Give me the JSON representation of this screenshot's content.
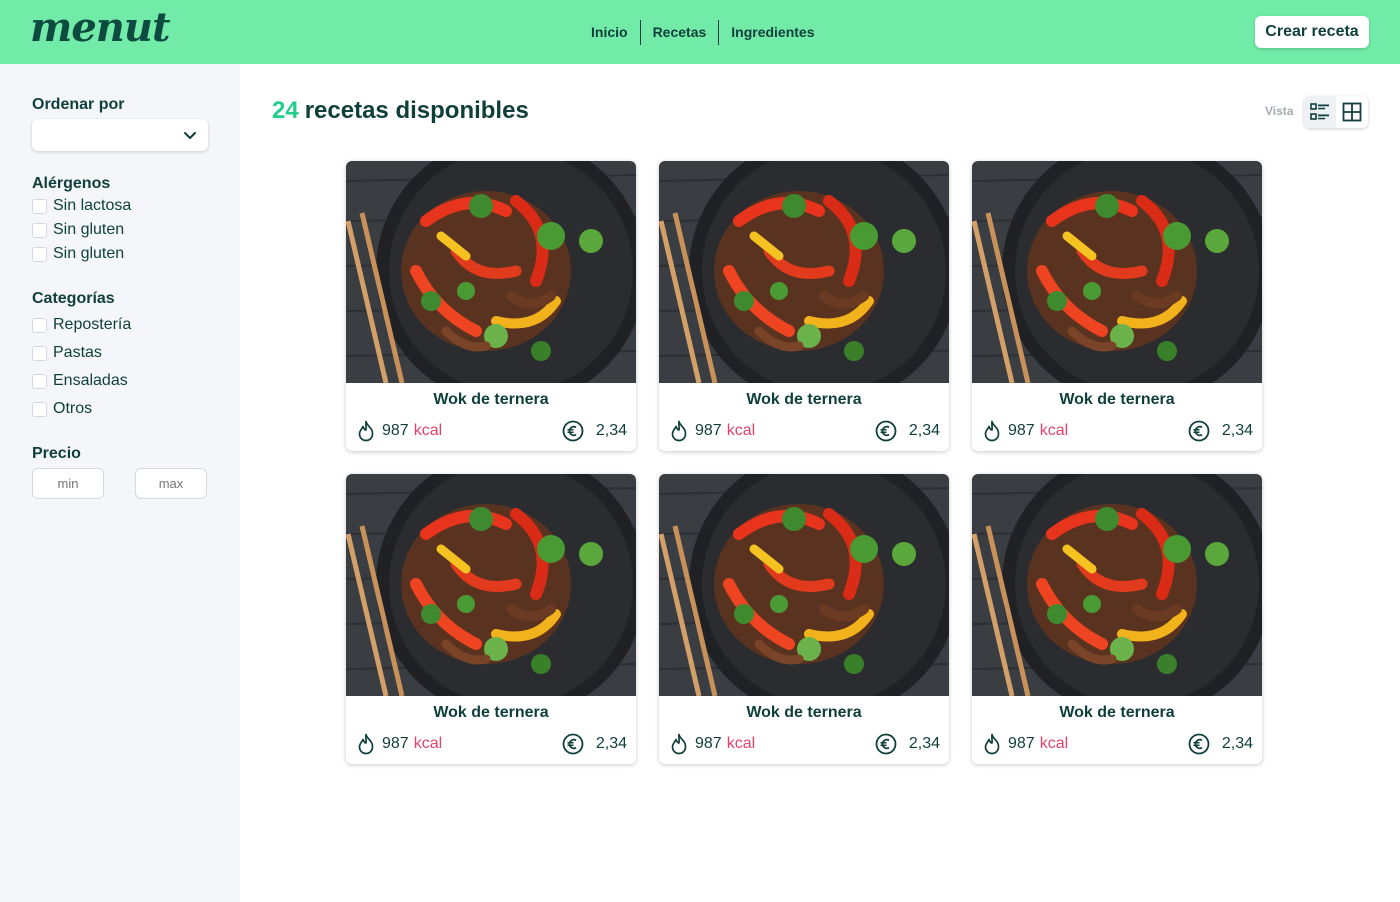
{
  "header": {
    "logo": "menut",
    "nav": [
      "Inicio",
      "Recetas",
      "Ingredientes"
    ],
    "cta": "Crear receta"
  },
  "sidebar": {
    "sort_label": "Ordenar por",
    "sort_value": "",
    "allergens_title": "Alérgenos",
    "allergens": [
      "Sin lactosa",
      "Sin gluten",
      "Sin gluten"
    ],
    "categories_title": "Categorías",
    "categories": [
      "Repostería",
      "Pastas",
      "Ensaladas",
      "Otros"
    ],
    "price_title": "Precio",
    "price_min_placeholder": "min",
    "price_max_placeholder": "max"
  },
  "main": {
    "count": "24",
    "title": "recetas disponibles",
    "view_label": "Vista",
    "view_icons": [
      "list-view-icon",
      "grid-view-icon"
    ],
    "active_view": "list"
  },
  "recipes": [
    {
      "title": "Wok de ternera",
      "kcal": "987",
      "kcal_unit": "kcal",
      "price": "2,34"
    },
    {
      "title": "Wok de ternera",
      "kcal": "987",
      "kcal_unit": "kcal",
      "price": "2,34"
    },
    {
      "title": "Wok de ternera",
      "kcal": "987",
      "kcal_unit": "kcal",
      "price": "2,34"
    },
    {
      "title": "Wok de ternera",
      "kcal": "987",
      "kcal_unit": "kcal",
      "price": "2,34"
    },
    {
      "title": "Wok de ternera",
      "kcal": "987",
      "kcal_unit": "kcal",
      "price": "2,34"
    },
    {
      "title": "Wok de ternera",
      "kcal": "987",
      "kcal_unit": "kcal",
      "price": "2,34"
    }
  ],
  "colors": {
    "header_bg": "#72eba8",
    "brand_dark": "#0f3f3a",
    "accent_green": "#22cf8a",
    "kcal_unit": "#e0446a",
    "sidebar_bg": "#f4f6f9"
  }
}
